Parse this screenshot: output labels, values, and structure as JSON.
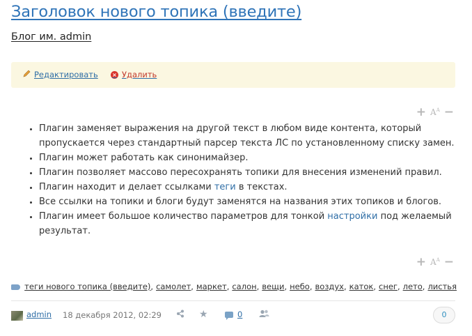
{
  "topic": {
    "title": "Заголовок нового топика (введите)",
    "blog": "Блог им. admin"
  },
  "actions": {
    "edit_label": "Редактировать",
    "delete_label": "Удалить"
  },
  "font_tools": {
    "increase": "+",
    "size_glyph": "A",
    "decrease": "−"
  },
  "content": {
    "items": [
      {
        "text": "Плагин заменяет выражения на другой текст в любом виде контента, который пропускается через стандартный парсер текста ЛС по установленному списку замен."
      },
      {
        "text": "Плагин может работать как синонимайзер."
      },
      {
        "text": "Плагин позволяет массово пересохранять топики для внесения изменений правил."
      },
      {
        "before": "Плагин находит и делает ссылками ",
        "link": "теги",
        "after": " в текстах."
      },
      {
        "text": "Все ссылки на топики и блоги будут заменятся на названия этих топиков и блогов."
      },
      {
        "before": "Плагин имеет большое количество параметров для тонкой ",
        "link": "настройки",
        "after": " под желаемый результат."
      }
    ]
  },
  "tags": [
    "теги нового топика (введите)",
    "самолет",
    "маркет",
    "салон",
    "вещи",
    "небо",
    "воздух",
    "каток",
    "снег",
    "лето",
    "листья"
  ],
  "footer": {
    "author": "admin",
    "date": "18 декабря 2012, 02:29",
    "comments_count": "0",
    "vote": "0"
  },
  "colors": {
    "link": "#2f6ea6",
    "title": "#2f74b8",
    "actions_bg": "#fbf7e1",
    "delete": "#d9342b"
  }
}
